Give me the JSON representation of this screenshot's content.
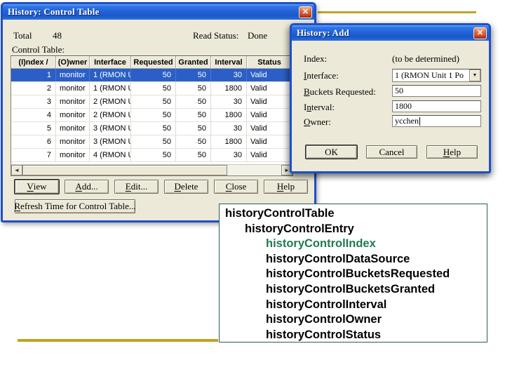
{
  "icons": {
    "close": "✕",
    "dropdown": "▼",
    "scroll_left": "◄",
    "scroll_right": "►"
  },
  "colors": {
    "gold": "#C2A226",
    "selection": "#2B5FC7",
    "mib_highlight": "#1E7B50",
    "titlebar_blue": "#2264D8"
  },
  "win1": {
    "title": "History: Control Table",
    "total_label": "Total",
    "total_value": "48",
    "read_status_label": "Read Status:",
    "read_status_value": "Done",
    "table_label": "Control Table:",
    "columns": [
      "(I)ndex /",
      "(O)wner",
      "Interface",
      "Requested",
      "Granted",
      "Interval",
      "Status"
    ],
    "rows": [
      {
        "index": "1",
        "owner": "monitor",
        "iface": "1 (RMON U",
        "requested": "50",
        "granted": "50",
        "interval": "30",
        "status": "Valid"
      },
      {
        "index": "2",
        "owner": "monitor",
        "iface": "1 (RMON U",
        "requested": "50",
        "granted": "50",
        "interval": "1800",
        "status": "Valid"
      },
      {
        "index": "3",
        "owner": "monitor",
        "iface": "2 (RMON U",
        "requested": "50",
        "granted": "50",
        "interval": "30",
        "status": "Valid"
      },
      {
        "index": "4",
        "owner": "monitor",
        "iface": "2 (RMON U",
        "requested": "50",
        "granted": "50",
        "interval": "1800",
        "status": "Valid"
      },
      {
        "index": "5",
        "owner": "monitor",
        "iface": "3 (RMON U",
        "requested": "50",
        "granted": "50",
        "interval": "30",
        "status": "Valid"
      },
      {
        "index": "6",
        "owner": "monitor",
        "iface": "3 (RMON U",
        "requested": "50",
        "granted": "50",
        "interval": "1800",
        "status": "Valid"
      },
      {
        "index": "7",
        "owner": "monitor",
        "iface": "4 (RMON U",
        "requested": "50",
        "granted": "50",
        "interval": "30",
        "status": "Valid"
      }
    ],
    "buttons": {
      "view": {
        "pre": "",
        "key": "V",
        "rest": "iew"
      },
      "add": {
        "pre": "",
        "key": "A",
        "rest": "dd..."
      },
      "edit": {
        "pre": "",
        "key": "E",
        "rest": "dit..."
      },
      "del": {
        "pre": "",
        "key": "D",
        "rest": "elete"
      },
      "close": {
        "pre": "",
        "key": "C",
        "rest": "lose"
      },
      "help": {
        "pre": "",
        "key": "H",
        "rest": "elp"
      },
      "refresh": {
        "pre": "",
        "key": "R",
        "rest": "efresh Time for Control Table..."
      }
    }
  },
  "win2": {
    "title": "History: Add",
    "index_label": {
      "pre": "Index:",
      "key": "",
      "rest": ""
    },
    "index_value": "(to be determined)",
    "interface_label": {
      "pre": "",
      "key": "I",
      "rest": "nterface:"
    },
    "interface_value": "1 (RMON Unit 1 Po",
    "buckets_label": {
      "pre": "",
      "key": "B",
      "rest": "uckets Requested:"
    },
    "buckets_value": "50",
    "interval_label": {
      "pre": "I",
      "key": "n",
      "rest": "terval:"
    },
    "interval_value": "1800",
    "owner_label": {
      "pre": "",
      "key": "O",
      "rest": "wner:"
    },
    "owner_value": "ycchen",
    "buttons": {
      "ok": {
        "pre": "OK",
        "key": "",
        "rest": ""
      },
      "cancel": {
        "pre": "Cancel",
        "key": "",
        "rest": ""
      },
      "help": {
        "pre": "",
        "key": "H",
        "rest": "elp"
      }
    }
  },
  "mib": {
    "lines": [
      {
        "text": "historyControlTable",
        "indent": 0,
        "highlight": false
      },
      {
        "text": "historyControlEntry",
        "indent": 1,
        "highlight": false
      },
      {
        "text": "historyControlIndex",
        "indent": 2,
        "highlight": true
      },
      {
        "text": "historyControlDataSource",
        "indent": 2,
        "highlight": false
      },
      {
        "text": "historyControlBucketsRequested",
        "indent": 2,
        "highlight": false
      },
      {
        "text": "historyControlBucketsGranted",
        "indent": 2,
        "highlight": false
      },
      {
        "text": "historyControlInterval",
        "indent": 2,
        "highlight": false
      },
      {
        "text": "historyControlOwner",
        "indent": 2,
        "highlight": false
      },
      {
        "text": "historyControlStatus",
        "indent": 2,
        "highlight": false
      }
    ]
  }
}
